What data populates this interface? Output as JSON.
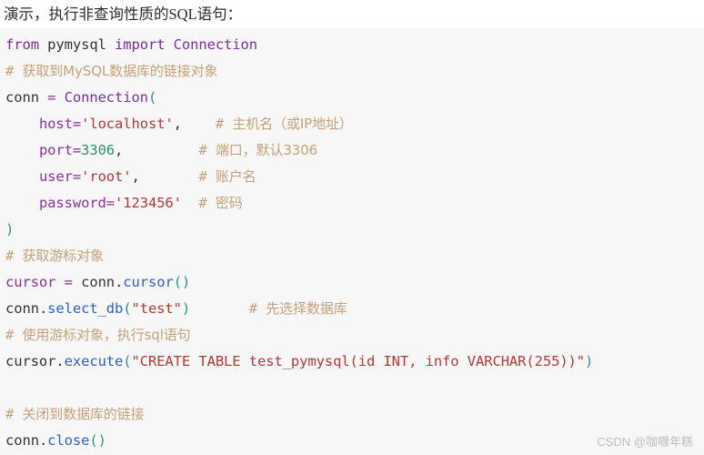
{
  "caption": "演示，执行非查询性质的SQL语句：",
  "watermark": "CSDN @咖喱年糕",
  "colors": {
    "page_background": "#ffffff",
    "code_background": "#f7f7f7",
    "keyword": "#7928a1",
    "class_name": "#7b2fa8",
    "function": "#2f5fd0",
    "string": "#b03a36",
    "number": "#2a8f6d",
    "comment": "#c6a079",
    "paren": "#2f8f8f",
    "plain_text": "#333333",
    "watermark": "#bdbdbd",
    "caption_text": "#2b2b2b"
  },
  "code": {
    "language": "python",
    "lines": [
      {
        "id": "line-import",
        "tokens": [
          {
            "t": "from",
            "c": "kw"
          },
          {
            "t": " ",
            "c": "plain"
          },
          {
            "t": "pymysql",
            "c": "name"
          },
          {
            "t": " ",
            "c": "plain"
          },
          {
            "t": "import",
            "c": "kw"
          },
          {
            "t": " ",
            "c": "plain"
          },
          {
            "t": "Connection",
            "c": "cls"
          }
        ]
      },
      {
        "id": "line-comment-conn-object",
        "tokens": [
          {
            "t": "# ",
            "c": "comment"
          },
          {
            "t": "获取到MySQL数据库的链接对象",
            "c": "comment",
            "cjk": true
          }
        ]
      },
      {
        "id": "line-conn-assign",
        "tokens": [
          {
            "t": "conn ",
            "c": "name"
          },
          {
            "t": "=",
            "c": "op"
          },
          {
            "t": " ",
            "c": "plain"
          },
          {
            "t": "Connection",
            "c": "cls"
          },
          {
            "t": "(",
            "c": "paren"
          }
        ]
      },
      {
        "id": "line-host",
        "tokens": [
          {
            "t": "    ",
            "c": "plain"
          },
          {
            "t": "host",
            "c": "kwarg"
          },
          {
            "t": "=",
            "c": "op"
          },
          {
            "t": "'localhost'",
            "c": "str"
          },
          {
            "t": ",",
            "c": "plain"
          },
          {
            "t": "    ",
            "c": "plain"
          },
          {
            "t": "# ",
            "c": "comment"
          },
          {
            "t": "主机名（或IP地址）",
            "c": "comment",
            "cjk": true
          }
        ]
      },
      {
        "id": "line-port",
        "tokens": [
          {
            "t": "    ",
            "c": "plain"
          },
          {
            "t": "port",
            "c": "kwarg"
          },
          {
            "t": "=",
            "c": "op"
          },
          {
            "t": "3306",
            "c": "num"
          },
          {
            "t": ",",
            "c": "plain"
          },
          {
            "t": "         ",
            "c": "plain"
          },
          {
            "t": "# ",
            "c": "comment"
          },
          {
            "t": "端口，默认3306",
            "c": "comment",
            "cjk": true
          }
        ]
      },
      {
        "id": "line-user",
        "tokens": [
          {
            "t": "    ",
            "c": "plain"
          },
          {
            "t": "user",
            "c": "kwarg"
          },
          {
            "t": "=",
            "c": "op"
          },
          {
            "t": "'root'",
            "c": "str"
          },
          {
            "t": ",",
            "c": "plain"
          },
          {
            "t": "       ",
            "c": "plain"
          },
          {
            "t": "# ",
            "c": "comment"
          },
          {
            "t": "账户名",
            "c": "comment",
            "cjk": true
          }
        ]
      },
      {
        "id": "line-password",
        "tokens": [
          {
            "t": "    ",
            "c": "plain"
          },
          {
            "t": "password",
            "c": "kwarg"
          },
          {
            "t": "=",
            "c": "op"
          },
          {
            "t": "'123456'",
            "c": "str"
          },
          {
            "t": "  ",
            "c": "plain"
          },
          {
            "t": "# ",
            "c": "comment"
          },
          {
            "t": "密码",
            "c": "comment",
            "cjk": true
          }
        ]
      },
      {
        "id": "line-close-paren",
        "tokens": [
          {
            "t": ")",
            "c": "paren"
          }
        ]
      },
      {
        "id": "line-comment-cursor-object",
        "tokens": [
          {
            "t": "# ",
            "c": "comment"
          },
          {
            "t": "获取游标对象",
            "c": "comment",
            "cjk": true
          }
        ]
      },
      {
        "id": "line-cursor-assign",
        "tokens": [
          {
            "t": "cursor",
            "c": "kwarg"
          },
          {
            "t": " ",
            "c": "plain"
          },
          {
            "t": "=",
            "c": "op"
          },
          {
            "t": " ",
            "c": "plain"
          },
          {
            "t": "conn",
            "c": "name"
          },
          {
            "t": ".",
            "c": "plain"
          },
          {
            "t": "cursor",
            "c": "fn"
          },
          {
            "t": "()",
            "c": "paren"
          }
        ]
      },
      {
        "id": "line-select-db",
        "tokens": [
          {
            "t": "conn",
            "c": "name"
          },
          {
            "t": ".",
            "c": "plain"
          },
          {
            "t": "select_db",
            "c": "fn"
          },
          {
            "t": "(",
            "c": "paren"
          },
          {
            "t": "\"test\"",
            "c": "str"
          },
          {
            "t": ")",
            "c": "paren"
          },
          {
            "t": "       ",
            "c": "plain"
          },
          {
            "t": "# ",
            "c": "comment"
          },
          {
            "t": "先选择数据库",
            "c": "comment",
            "cjk": true
          }
        ]
      },
      {
        "id": "line-comment-execute-sql",
        "tokens": [
          {
            "t": "# ",
            "c": "comment"
          },
          {
            "t": "使用游标对象，执行sql语句",
            "c": "comment",
            "cjk": true
          }
        ]
      },
      {
        "id": "line-execute",
        "tokens": [
          {
            "t": "cursor",
            "c": "name"
          },
          {
            "t": ".",
            "c": "plain"
          },
          {
            "t": "execute",
            "c": "fn"
          },
          {
            "t": "(",
            "c": "paren"
          },
          {
            "t": "\"CREATE TABLE test_pymysql(id INT, info VARCHAR(255))\"",
            "c": "str"
          },
          {
            "t": ")",
            "c": "paren"
          }
        ]
      },
      {
        "id": "line-blank-1",
        "tokens": []
      },
      {
        "id": "line-comment-close-conn",
        "tokens": [
          {
            "t": "# ",
            "c": "comment"
          },
          {
            "t": "关闭到数据库的链接",
            "c": "comment",
            "cjk": true
          }
        ]
      },
      {
        "id": "line-conn-close",
        "tokens": [
          {
            "t": "conn",
            "c": "name"
          },
          {
            "t": ".",
            "c": "plain"
          },
          {
            "t": "close",
            "c": "fn"
          },
          {
            "t": "()",
            "c": "paren"
          }
        ]
      }
    ]
  }
}
